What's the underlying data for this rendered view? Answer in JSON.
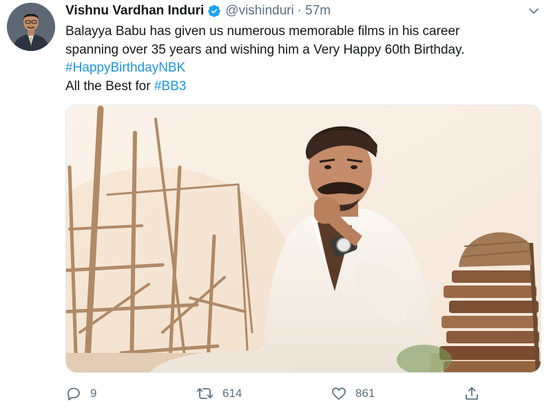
{
  "tweet": {
    "author_name": "Vishnu Vardhan Induri",
    "handle": "@vishinduri",
    "separator": "·",
    "time": "57m",
    "text_lines": [
      "Balayya Babu has given us numerous memorable films in his career",
      "spanning over 35 years and wishing him a Very Happy 60th Birthday."
    ],
    "hashtag_line": "#HappyBirthdayNBK",
    "closing_prefix": "All the Best for ",
    "closing_hashtag": "#BB3"
  },
  "icons": {
    "verified": "verified-badge-icon",
    "more": "chevron-down-icon",
    "reply": "reply-icon",
    "retweet": "retweet-icon",
    "like": "heart-icon",
    "share": "share-icon"
  },
  "actions": {
    "reply_count": "9",
    "retweet_count": "614",
    "like_count": "861"
  },
  "colors": {
    "link": "#1b95e0",
    "secondary_text": "#5b7083",
    "verified": "#1da1f2"
  }
}
